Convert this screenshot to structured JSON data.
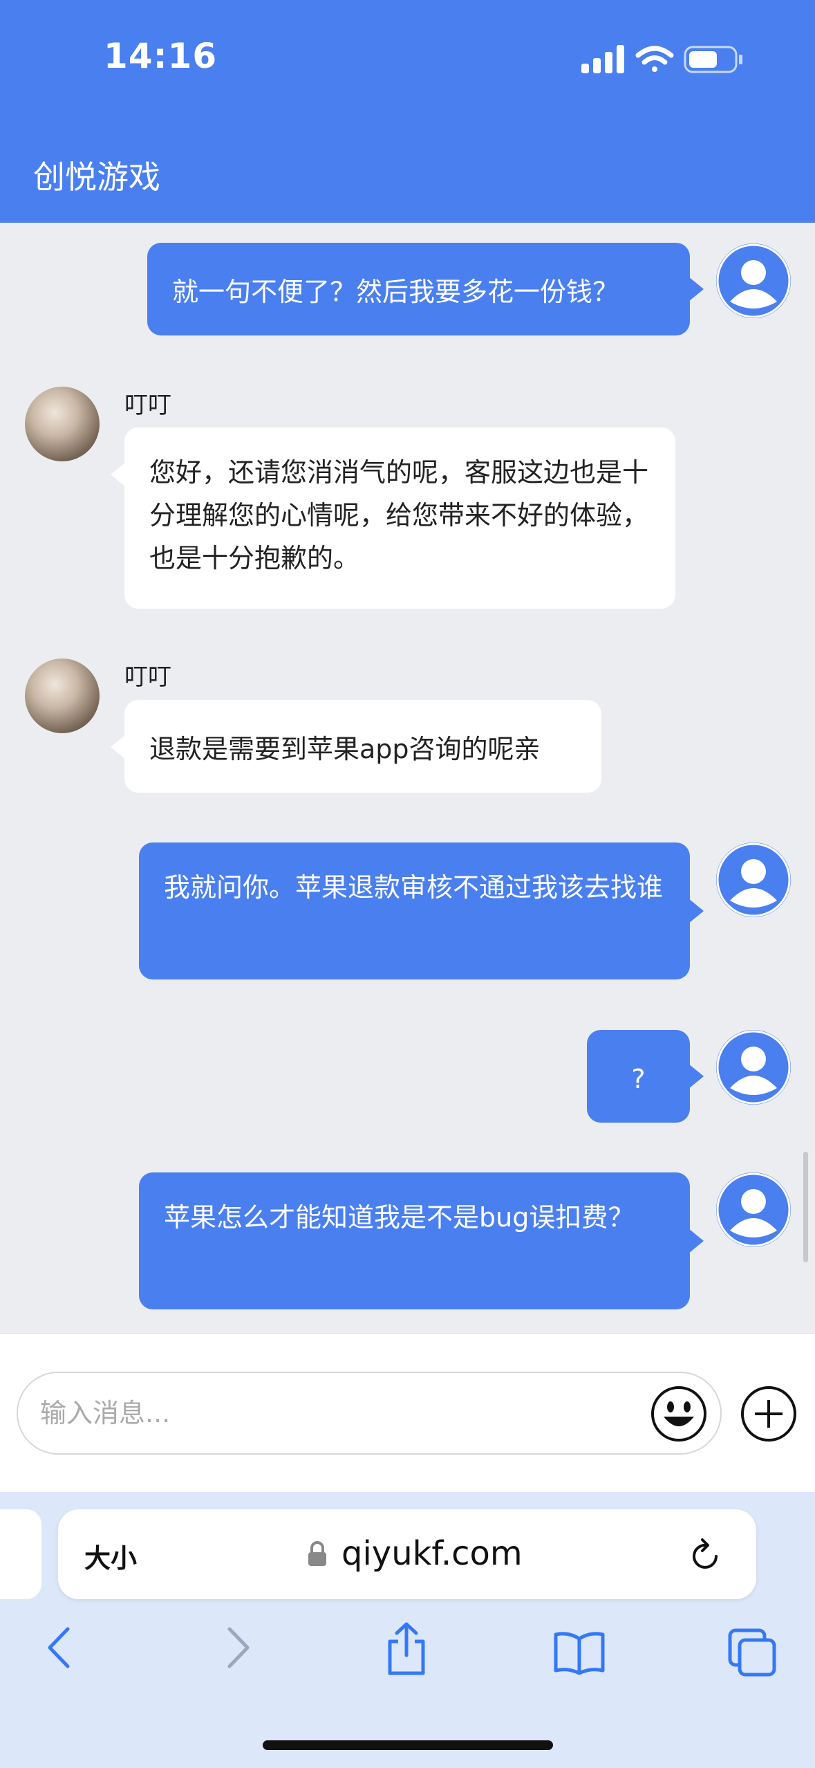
{
  "status_bar": {
    "time": "14:16"
  },
  "header": {
    "title": "创悦游戏"
  },
  "messages": [
    {
      "side": "out",
      "text": "就一句不便了？然后我要多花一份钱？"
    },
    {
      "side": "in",
      "sender": "叮叮",
      "text": "您好，还请您消消气的呢，客服这边也是十分理解您的心情呢，给您带来不好的体验，也是十分抱歉的。"
    },
    {
      "side": "in",
      "sender": "叮叮",
      "text": "退款是需要到苹果app咨询的呢亲"
    },
    {
      "side": "out",
      "text": "我就问你。苹果退款审核不通过我该去找谁"
    },
    {
      "side": "out",
      "text": "?"
    },
    {
      "side": "out",
      "text": "苹果怎么才能知道我是不是bug误扣费？"
    }
  ],
  "input": {
    "placeholder": "输入消息..."
  },
  "browser": {
    "text_size_label": "大小",
    "url": "qiyukf.com"
  },
  "icons": {
    "emoji": "smiley-icon",
    "plus": "plus-circle-icon",
    "back": "chevron-left-icon",
    "forward": "chevron-right-icon",
    "share": "share-icon",
    "bookmarks": "book-icon",
    "tabs": "tabs-icon"
  },
  "colors": {
    "accent": "#4a7ff0",
    "chat_bg": "#ecedf0",
    "safari_bg": "#dce7fa"
  }
}
